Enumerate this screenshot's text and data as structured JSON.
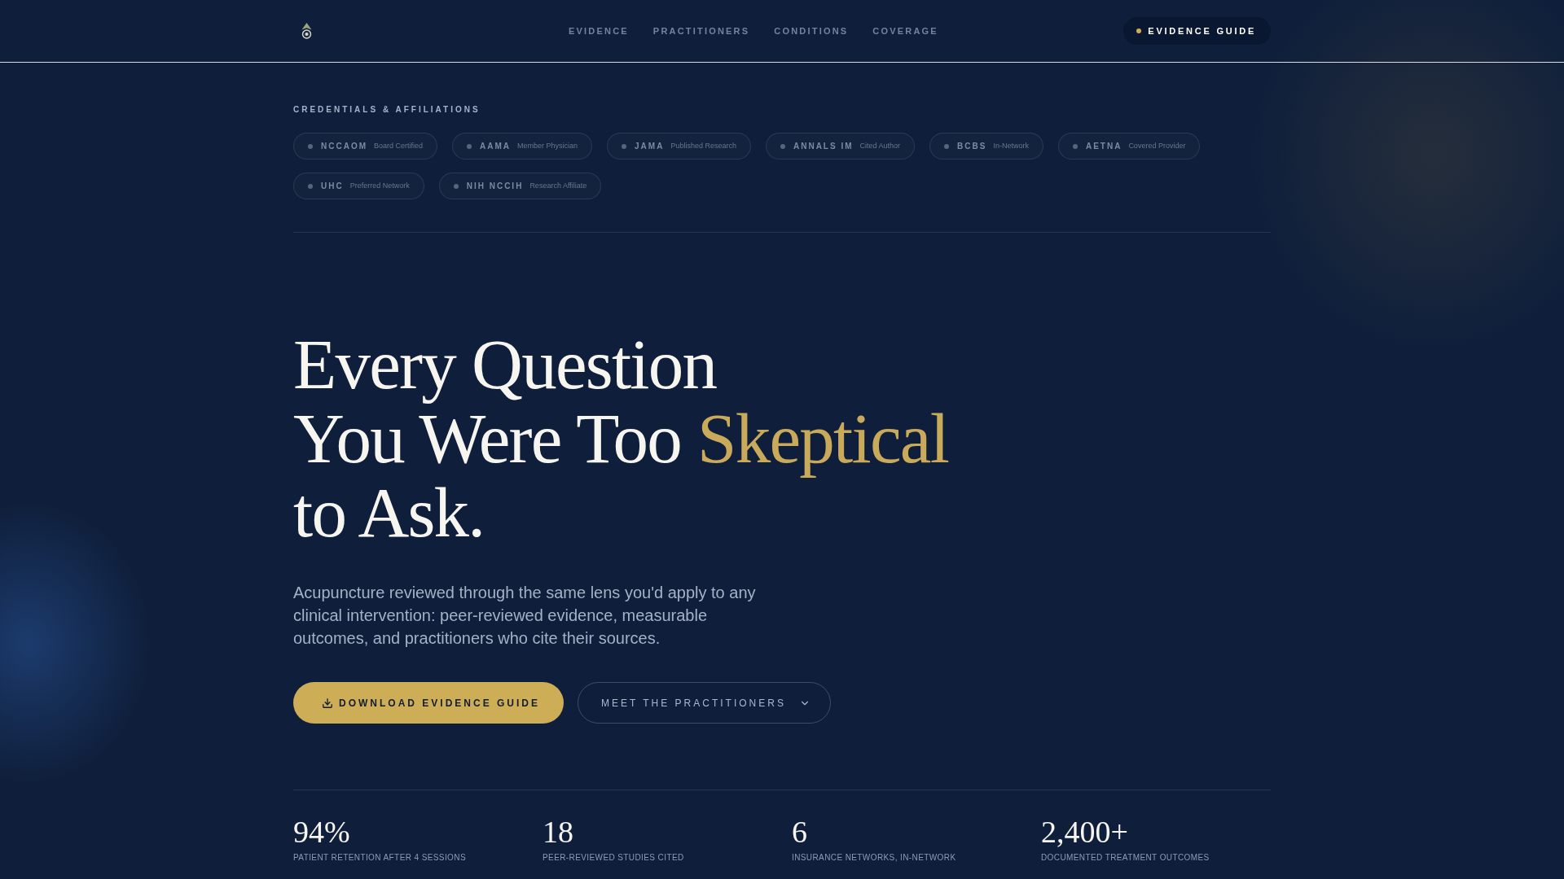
{
  "nav": {
    "links": [
      "EVIDENCE",
      "PRACTITIONERS",
      "CONDITIONS",
      "COVERAGE"
    ],
    "cta": "EVIDENCE GUIDE"
  },
  "credentials": {
    "label": "CREDENTIALS & AFFILIATIONS",
    "badges": [
      {
        "name": "NCCAOM",
        "detail": "Board Certified"
      },
      {
        "name": "AAMA",
        "detail": "Member Physician"
      },
      {
        "name": "JAMA",
        "detail": "Published Research"
      },
      {
        "name": "ANNALS IM",
        "detail": "Cited Author"
      },
      {
        "name": "BCBS",
        "detail": "In-Network"
      },
      {
        "name": "AETNA",
        "detail": "Covered Provider"
      },
      {
        "name": "UHC",
        "detail": "Preferred Network"
      },
      {
        "name": "NIH NCCIH",
        "detail": "Research Affiliate"
      }
    ]
  },
  "hero": {
    "headline": [
      [
        {
          "text": "Every Question",
          "highlight": false
        }
      ],
      [
        {
          "text": "You Were Too",
          "highlight": false
        },
        {
          "text": "Skeptical",
          "highlight": true
        }
      ],
      [
        {
          "text": "to Ask.",
          "highlight": false
        }
      ]
    ],
    "intro": "Acupuncture reviewed through the same lens you'd apply to any clinical intervention: peer-reviewed evidence, measurable outcomes, and practitioners who cite their sources.",
    "actions": [
      {
        "kind": "primary",
        "label": "DOWNLOAD EVIDENCE GUIDE"
      },
      {
        "kind": "secondary",
        "label": "MEET THE PRACTITIONERS"
      }
    ]
  },
  "stats": [
    {
      "value": "94%",
      "label": "PATIENT RETENTION AFTER 4 SESSIONS"
    },
    {
      "value": "18",
      "label": "PEER-REVIEWED STUDIES CITED"
    },
    {
      "value": "6",
      "label": "INSURANCE NETWORKS, IN-NETWORK"
    },
    {
      "value": "2,400+",
      "label": "DOCUMENTED TREATMENT OUTCOMES"
    }
  ]
}
